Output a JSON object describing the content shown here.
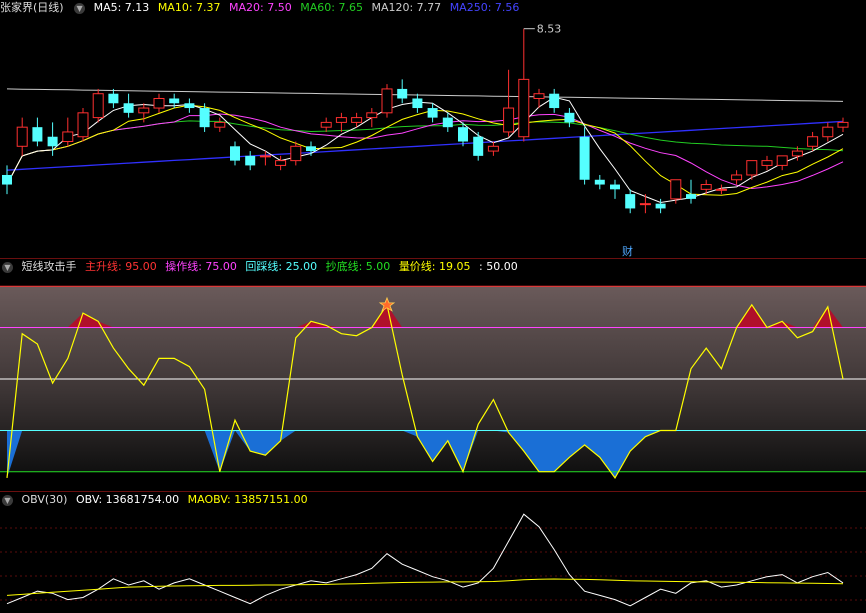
{
  "price_panel": {
    "title": "张家界(日线)",
    "ma5": "MA5: 7.13",
    "ma10": "MA10: 7.37",
    "ma20": "MA20: 7.50",
    "ma60": "MA60: 7.65",
    "ma120": "MA120: 7.77",
    "ma250": "MA250: 7.56",
    "high_label": "8.53",
    "finance_marker": "财",
    "colors": {
      "ma5": "#ffffff",
      "ma10": "#ffff00",
      "ma20": "#ff44ff",
      "ma60": "#22cc22",
      "ma120": "#cccccc",
      "ma250": "#3030ff",
      "up": "#ff3030",
      "down": "#55ffff"
    }
  },
  "indicator_panel": {
    "title": "短线攻击手",
    "main_up": "主升线: 95.00",
    "operate": "操作线: 75.00",
    "pullback": "回踩线: 25.00",
    "bottom": "抄底线: 5.00",
    "volume_price": "量价线: 19.05",
    "mid": ": 50.00",
    "colors": {
      "main_up": "#ff3030",
      "operate": "#ff44ff",
      "pullback": "#55ffff",
      "bottom": "#22dd22",
      "volume_price": "#ffff00",
      "mid": "#ffffff"
    }
  },
  "obv_panel": {
    "title": "OBV(30)",
    "obv": "OBV: 13681754.00",
    "maobv": "MAOBV: 13857151.00",
    "colors": {
      "obv": "#ffffff",
      "maobv": "#ffff00"
    }
  },
  "chart_data": [
    {
      "type": "candlestick",
      "title": "张家界(日线)",
      "annotations": [
        "8.53",
        "财"
      ],
      "series": [
        {
          "name": "MA5",
          "last": 7.13
        },
        {
          "name": "MA10",
          "last": 7.37
        },
        {
          "name": "MA20",
          "last": 7.5
        },
        {
          "name": "MA60",
          "last": 7.65
        },
        {
          "name": "MA120",
          "last": 7.77
        },
        {
          "name": "MA250",
          "last": 7.56
        }
      ],
      "candles": [
        [
          7.0,
          7.1,
          6.8,
          6.9
        ],
        [
          7.3,
          7.6,
          7.2,
          7.5
        ],
        [
          7.5,
          7.6,
          7.3,
          7.35
        ],
        [
          7.4,
          7.55,
          7.2,
          7.3
        ],
        [
          7.35,
          7.6,
          7.3,
          7.45
        ],
        [
          7.4,
          7.7,
          7.35,
          7.65
        ],
        [
          7.6,
          7.9,
          7.55,
          7.85
        ],
        [
          7.85,
          7.9,
          7.7,
          7.75
        ],
        [
          7.75,
          7.85,
          7.6,
          7.65
        ],
        [
          7.65,
          7.75,
          7.55,
          7.7
        ],
        [
          7.7,
          7.85,
          7.65,
          7.8
        ],
        [
          7.8,
          7.85,
          7.7,
          7.75
        ],
        [
          7.75,
          7.8,
          7.65,
          7.7
        ],
        [
          7.7,
          7.75,
          7.45,
          7.5
        ],
        [
          7.5,
          7.6,
          7.45,
          7.55
        ],
        [
          7.3,
          7.35,
          7.1,
          7.15
        ],
        [
          7.2,
          7.25,
          7.05,
          7.1
        ],
        [
          7.2,
          7.25,
          7.1,
          7.2
        ],
        [
          7.1,
          7.2,
          7.05,
          7.15
        ],
        [
          7.15,
          7.35,
          7.1,
          7.3
        ],
        [
          7.3,
          7.35,
          7.2,
          7.25
        ],
        [
          7.5,
          7.6,
          7.45,
          7.55
        ],
        [
          7.55,
          7.65,
          7.45,
          7.6
        ],
        [
          7.55,
          7.65,
          7.5,
          7.6
        ],
        [
          7.6,
          7.7,
          7.5,
          7.65
        ],
        [
          7.65,
          7.95,
          7.6,
          7.9
        ],
        [
          7.9,
          8.0,
          7.75,
          7.8
        ],
        [
          7.8,
          7.85,
          7.65,
          7.7
        ],
        [
          7.7,
          7.75,
          7.55,
          7.6
        ],
        [
          7.6,
          7.65,
          7.45,
          7.5
        ],
        [
          7.5,
          7.55,
          7.3,
          7.35
        ],
        [
          7.4,
          7.45,
          7.15,
          7.2
        ],
        [
          7.25,
          7.35,
          7.2,
          7.3
        ],
        [
          7.45,
          8.1,
          7.4,
          7.7
        ],
        [
          7.4,
          8.53,
          7.35,
          8.0
        ],
        [
          7.8,
          7.9,
          7.7,
          7.85
        ],
        [
          7.85,
          7.9,
          7.65,
          7.7
        ],
        [
          7.65,
          7.7,
          7.5,
          7.55
        ],
        [
          7.4,
          7.5,
          6.9,
          6.95
        ],
        [
          6.95,
          7.0,
          6.85,
          6.9
        ],
        [
          6.9,
          6.95,
          6.75,
          6.85
        ],
        [
          6.8,
          6.85,
          6.6,
          6.65
        ],
        [
          6.7,
          6.8,
          6.6,
          6.7
        ],
        [
          6.7,
          6.75,
          6.6,
          6.65
        ],
        [
          6.75,
          6.95,
          6.7,
          6.95
        ],
        [
          6.8,
          6.95,
          6.7,
          6.75
        ],
        [
          6.85,
          6.95,
          6.8,
          6.9
        ],
        [
          6.85,
          6.9,
          6.8,
          6.85
        ],
        [
          6.95,
          7.05,
          6.9,
          7.0
        ],
        [
          7.0,
          7.15,
          6.95,
          7.15
        ],
        [
          7.1,
          7.2,
          7.05,
          7.15
        ],
        [
          7.1,
          7.2,
          7.05,
          7.2
        ],
        [
          7.2,
          7.3,
          7.15,
          7.25
        ],
        [
          7.3,
          7.45,
          7.25,
          7.4
        ],
        [
          7.4,
          7.55,
          7.35,
          7.5
        ],
        [
          7.5,
          7.6,
          7.45,
          7.55
        ]
      ]
    },
    {
      "type": "line",
      "title": "短线攻击手",
      "ylim": [
        0,
        100
      ],
      "levels": [
        {
          "name": "主升线",
          "value": 95
        },
        {
          "name": "操作线",
          "value": 75
        },
        {
          "name": "回踩线",
          "value": 25
        },
        {
          "name": "抄底线",
          "value": 5
        },
        {
          "name": "",
          "value": 50
        }
      ],
      "series": [
        {
          "name": "量价线",
          "last": 19.05,
          "values": [
            2,
            72,
            67,
            48,
            60,
            82,
            78,
            65,
            55,
            47,
            60,
            60,
            56,
            45,
            5,
            30,
            15,
            13,
            20,
            70,
            78,
            76,
            72,
            71,
            75,
            86,
            52,
            22,
            10,
            20,
            5,
            28,
            40,
            24,
            15,
            5,
            5,
            12,
            18,
            12,
            2,
            15,
            22,
            25,
            25,
            55,
            65,
            55,
            75,
            86,
            75,
            78,
            70,
            73,
            85,
            50
          ]
        }
      ]
    },
    {
      "type": "line",
      "title": "OBV(30)",
      "series": [
        {
          "name": "OBV",
          "last": 13681754.0,
          "values": [
            12.9,
            13.2,
            13.5,
            13.4,
            13.1,
            13.2,
            13.6,
            14.1,
            13.8,
            14.0,
            13.6,
            13.9,
            14.1,
            13.8,
            13.5,
            13.2,
            12.9,
            13.3,
            13.6,
            13.8,
            14.0,
            13.9,
            14.1,
            14.3,
            14.6,
            15.3,
            14.8,
            14.5,
            14.2,
            14.0,
            13.7,
            13.9,
            14.6,
            15.9,
            17.2,
            16.6,
            15.5,
            14.3,
            13.5,
            13.3,
            13.1,
            12.8,
            13.2,
            13.6,
            13.4,
            13.9,
            14.0,
            13.7,
            13.8,
            14.0,
            14.2,
            14.3,
            13.9,
            14.2,
            14.4,
            13.9
          ]
        },
        {
          "name": "MAOBV",
          "last": 13857151.0,
          "values": [
            13.3,
            13.35,
            13.4,
            13.45,
            13.5,
            13.55,
            13.6,
            13.65,
            13.7,
            13.72,
            13.74,
            13.75,
            13.76,
            13.77,
            13.78,
            13.78,
            13.79,
            13.8,
            13.8,
            13.81,
            13.82,
            13.83,
            13.85,
            13.86,
            13.88,
            13.9,
            13.92,
            13.93,
            13.94,
            13.95,
            13.95,
            13.96,
            13.97,
            14.0,
            14.05,
            14.08,
            14.09,
            14.08,
            14.07,
            14.05,
            14.03,
            14.0,
            13.99,
            13.98,
            13.97,
            13.96,
            13.95,
            13.94,
            13.93,
            13.92,
            13.91,
            13.9,
            13.89,
            13.88,
            13.87,
            13.86
          ]
        }
      ]
    }
  ]
}
